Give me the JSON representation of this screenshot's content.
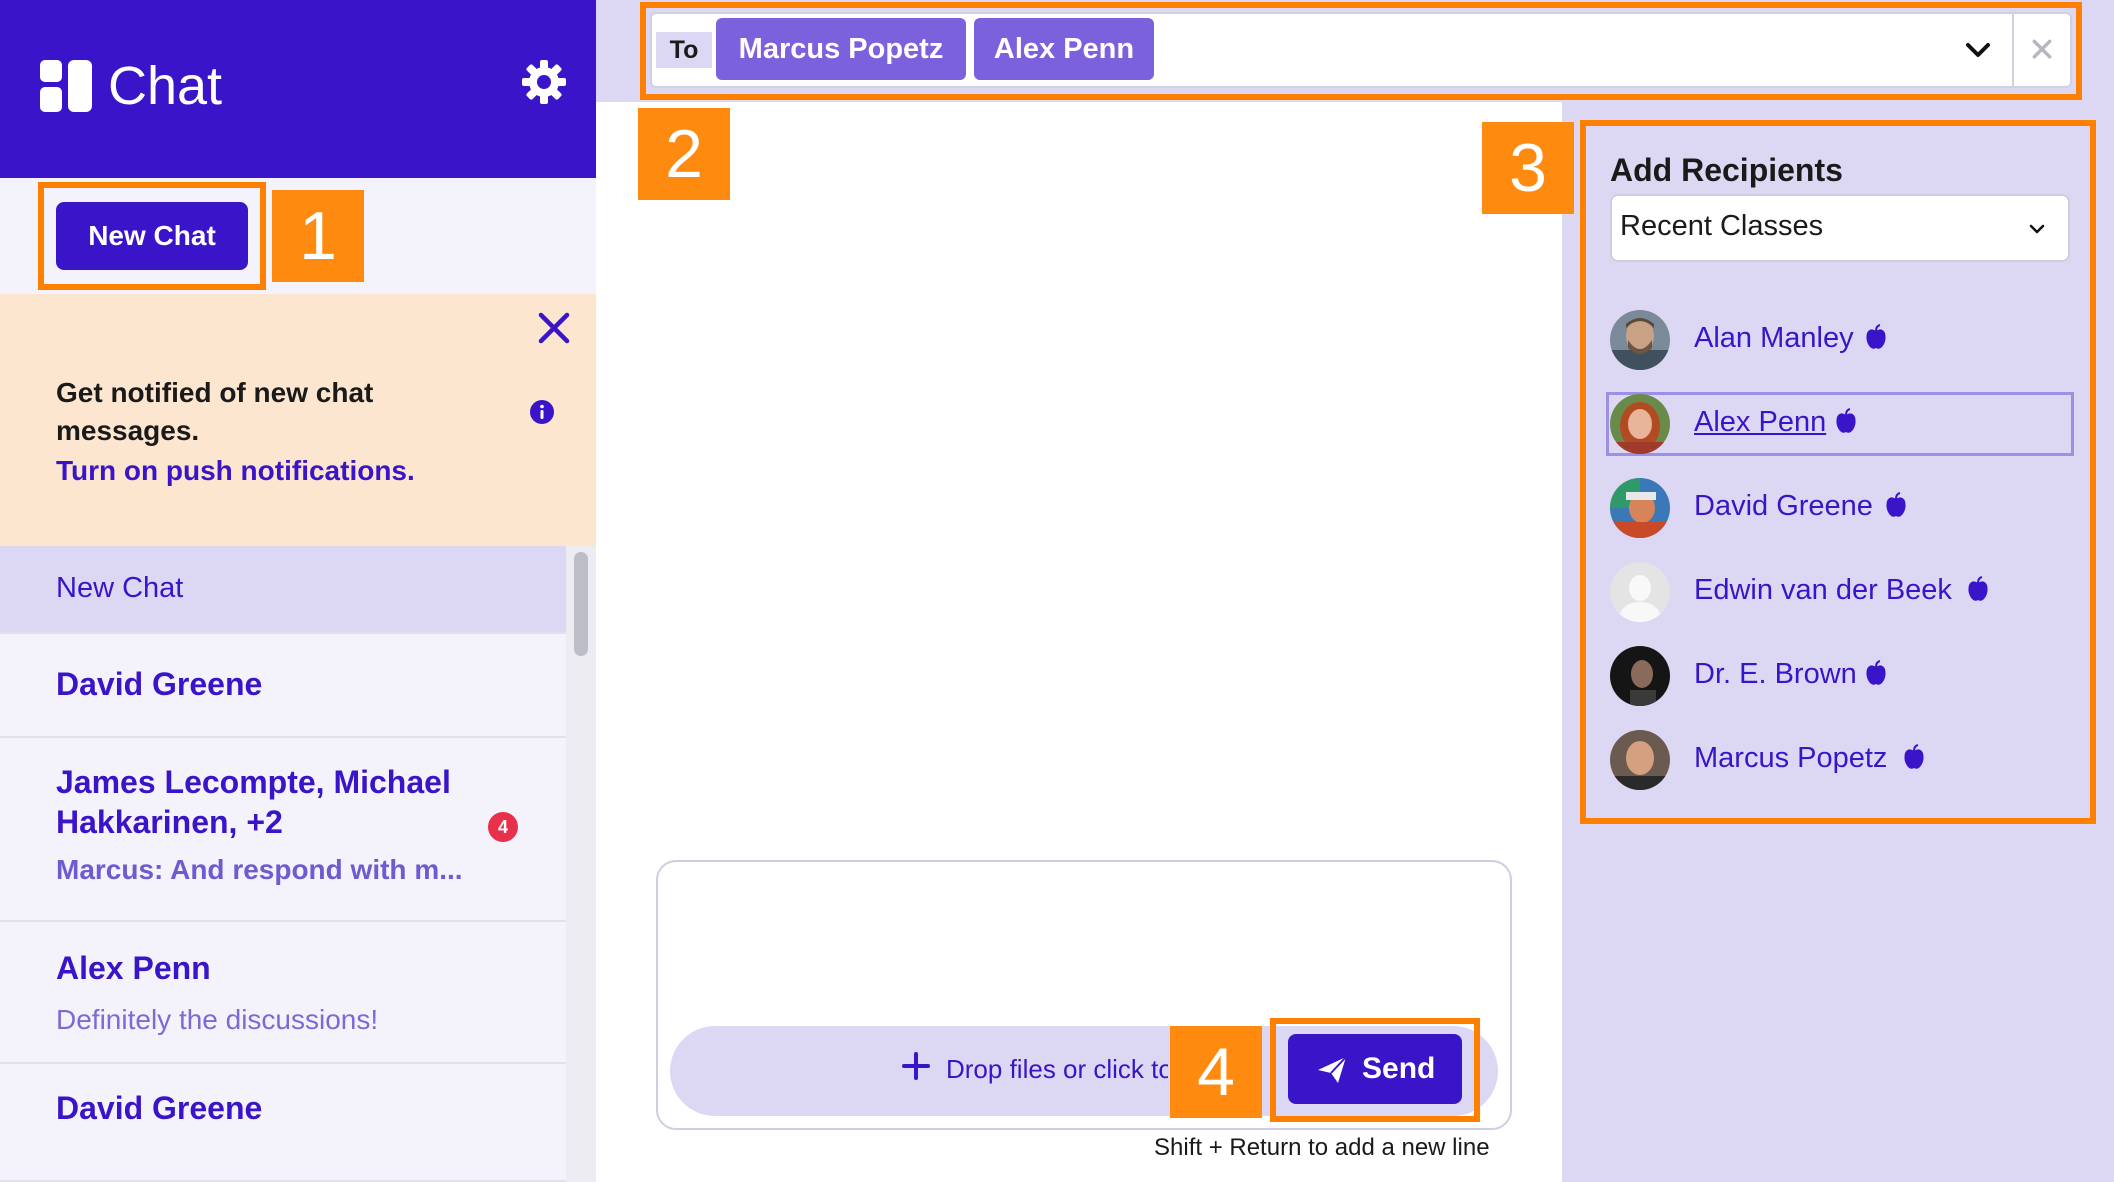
{
  "app": {
    "title": "Chat"
  },
  "sidebar": {
    "new_chat_label": "New Chat",
    "notice": {
      "text": "Get notified of new chat messages.",
      "link": "Turn on push notifications."
    },
    "chats": [
      {
        "name": "New Chat",
        "preview": "",
        "active": true
      },
      {
        "name": "David Greene",
        "preview": ""
      },
      {
        "name": "James Lecompte, Michael Hakkarinen, +2",
        "preview": "Marcus: And respond with m...",
        "unread": "4"
      },
      {
        "name": "Alex Penn",
        "preview": "Definitely the discussions!"
      },
      {
        "name": "David Greene",
        "preview": ""
      }
    ]
  },
  "to_bar": {
    "label": "To",
    "recipients": [
      "Marcus Popetz",
      "Alex Penn"
    ],
    "clear_symbol": "✕"
  },
  "composer": {
    "drop_text": "Drop files or click to",
    "send_label": "Send",
    "hint": "Shift + Return to add a new line"
  },
  "right_panel": {
    "title": "Add Recipients",
    "select_value": "Recent Classes",
    "people": [
      {
        "name": "Alan Manley",
        "icon": "apple-icon"
      },
      {
        "name": "Alex Penn",
        "icon": "apple-icon"
      },
      {
        "name": "David Greene",
        "icon": "apple-icon"
      },
      {
        "name": "Edwin van der Beek",
        "icon": "apple-icon"
      },
      {
        "name": "Dr. E. Brown",
        "icon": "apple-icon"
      },
      {
        "name": "Marcus Popetz",
        "icon": "apple-icon"
      }
    ]
  },
  "callouts": [
    "1",
    "2",
    "3",
    "4"
  ],
  "colors": {
    "brand": "#3a14c8",
    "chip": "#7c61dd",
    "panel": "#dcd8f4",
    "notice": "#fde6cf",
    "callout": "#ff7f00",
    "badge": "#e8304a"
  }
}
